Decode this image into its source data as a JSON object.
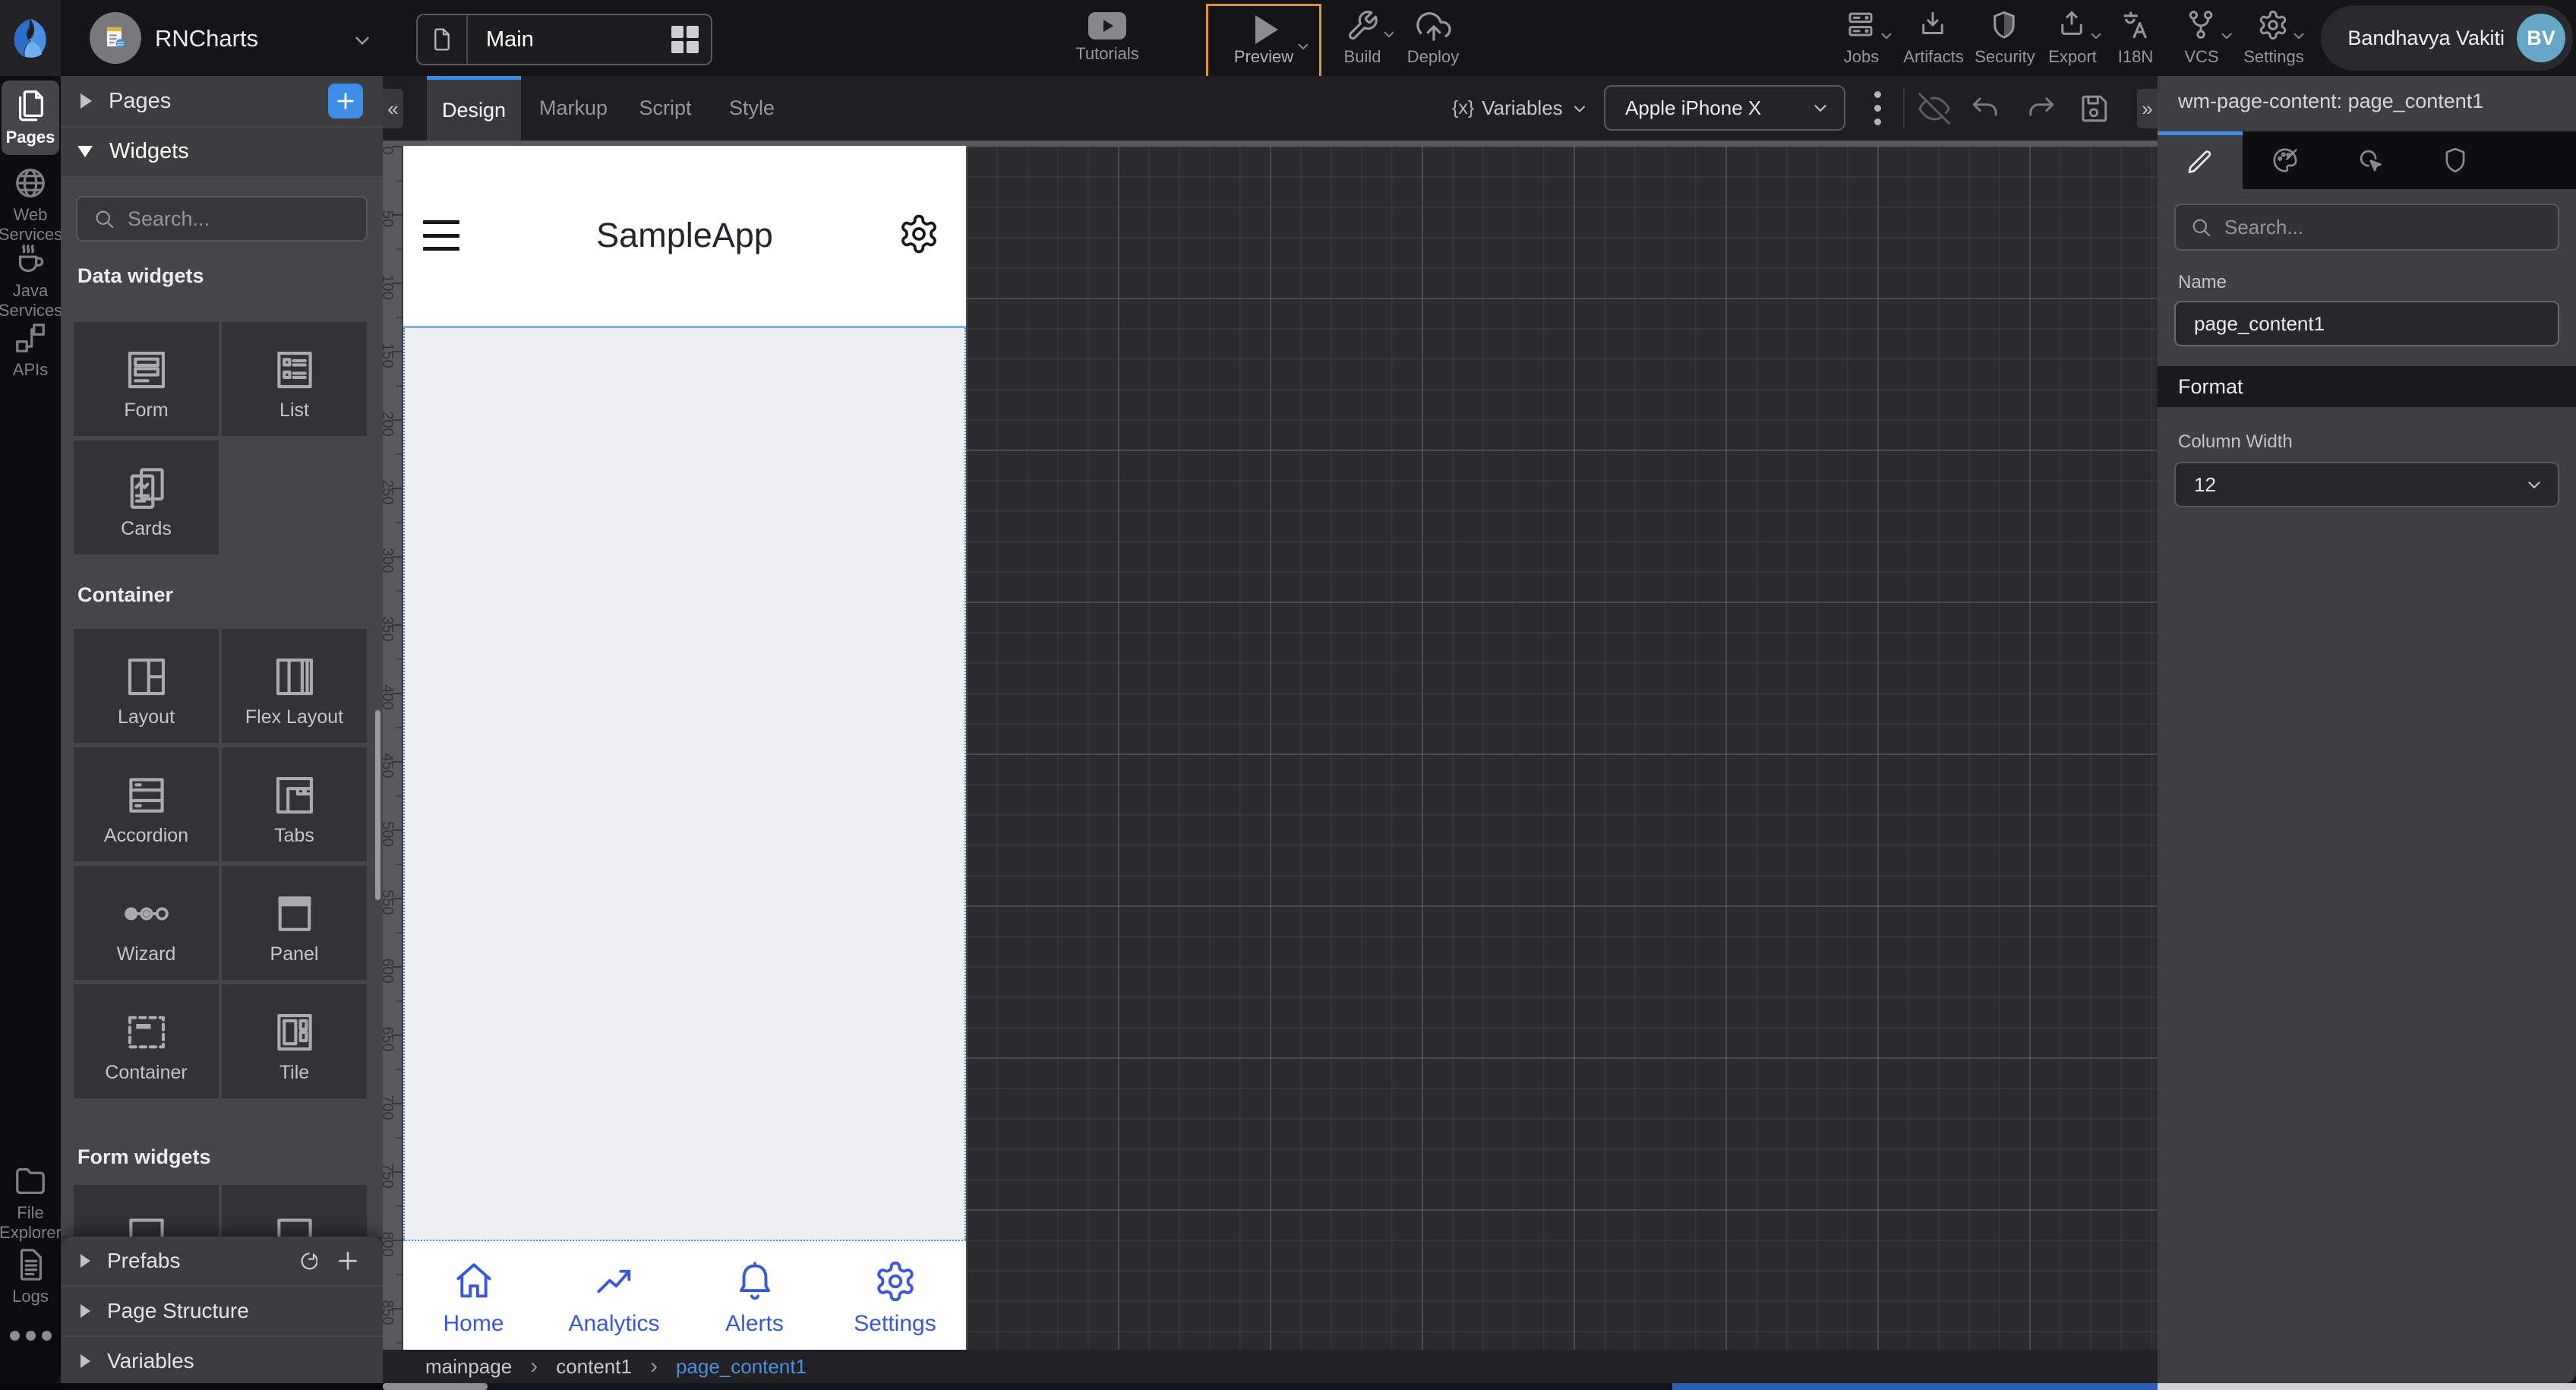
{
  "colors": {
    "accent_blue": "#3e8ee8",
    "preview_highlight_orange": "#d8973f",
    "phone_nav_blue": "#3a57d8",
    "avatar_teal": "#66a7c7",
    "breadcrumb_active_blue": "#4a90e2"
  },
  "topbar": {
    "project": {
      "name": "RNCharts"
    },
    "page_selector": {
      "label": "Main"
    },
    "tutorials_label": "Tutorials",
    "preview_label": "Preview",
    "build_label": "Build",
    "deploy_label": "Deploy",
    "jobs_label": "Jobs",
    "artifacts_label": "Artifacts",
    "security_label": "Security",
    "export_label": "Export",
    "i18n_label": "I18N",
    "vcs_label": "VCS",
    "settings_label": "Settings",
    "user": {
      "name": "Bandhavya Vakiti",
      "initials": "BV"
    }
  },
  "activity_bar": {
    "items": [
      {
        "label": "Pages",
        "active": true
      },
      {
        "label": "Web Services"
      },
      {
        "label": "Java Services"
      },
      {
        "label": "APIs"
      },
      {
        "label": "File Explorer"
      },
      {
        "label": "Logs"
      }
    ]
  },
  "explorer": {
    "pages_header": "Pages",
    "widgets_header": "Widgets",
    "search_placeholder": "Search...",
    "sections": [
      {
        "title": "Data widgets",
        "items": [
          "Form",
          "List",
          "Cards"
        ]
      },
      {
        "title": "Container",
        "items": [
          "Layout",
          "Flex Layout",
          "Accordion",
          "Tabs",
          "Wizard",
          "Panel",
          "Container",
          "Tile"
        ]
      },
      {
        "title": "Form widgets",
        "items": []
      }
    ],
    "footer_sections": [
      "Prefabs",
      "Page Structure",
      "Variables"
    ]
  },
  "canvas": {
    "tabs": [
      "Design",
      "Markup",
      "Script",
      "Style"
    ],
    "active_tab": "Design",
    "variables_icon": "{x}",
    "variables_label": "Variables",
    "device_selector": "Apple iPhone X",
    "ruler_numbers": [
      0,
      50,
      100,
      150,
      200,
      250,
      300,
      350,
      400,
      450,
      500,
      550,
      600,
      650,
      700,
      750,
      800,
      850
    ],
    "breadcrumb": [
      {
        "label": "mainpage",
        "active": false
      },
      {
        "label": "content1",
        "active": false
      },
      {
        "label": "page_content1",
        "active": true
      }
    ]
  },
  "phone": {
    "title": "SampleApp",
    "nav_items": [
      "Home",
      "Analytics",
      "Alerts",
      "Settings"
    ]
  },
  "inspector": {
    "title": "wm-page-content: page_content1",
    "search_placeholder": "Search...",
    "name_label": "Name",
    "name_value": "page_content1",
    "format_section": "Format",
    "column_width_label": "Column Width",
    "column_width_value": "12"
  }
}
